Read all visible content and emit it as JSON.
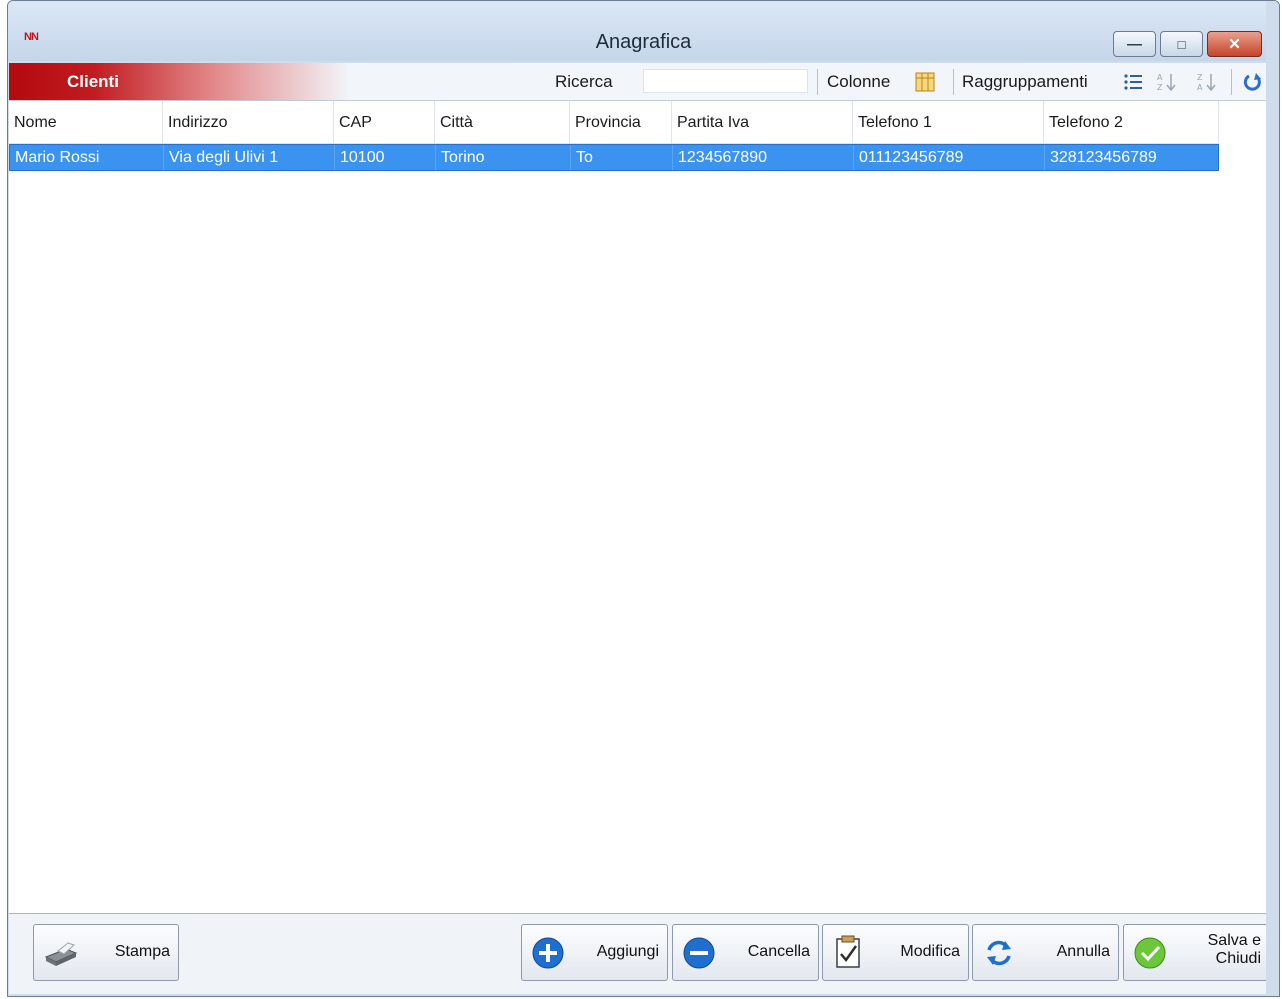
{
  "window": {
    "title": "Anagrafica",
    "app_icon_text": "NN",
    "controls": {
      "minimize": "minimize",
      "maximize": "maximize",
      "close": "close"
    }
  },
  "toolbar": {
    "section_title": "Clienti",
    "search_label": "Ricerca",
    "search_value": "",
    "columns_label": "Colonne",
    "grouping_label": "Raggruppamenti"
  },
  "table": {
    "columns": [
      "Nome",
      "Indirizzo",
      "CAP",
      "Città",
      "Provincia",
      "Partita Iva",
      "Telefono 1",
      "Telefono 2"
    ],
    "rows": [
      [
        "Mario Rossi",
        "Via degli Ulivi 1",
        "10100",
        "Torino",
        "To",
        "1234567890",
        "011123456789",
        "328123456789"
      ]
    ],
    "selected_row": 0,
    "selection_color": "#3b93f0"
  },
  "buttons": {
    "stampa": "Stampa",
    "aggiungi": "Aggiungi",
    "cancella": "Cancella",
    "modifica": "Modifica",
    "annulla": "Annulla",
    "salva_line1": "Salva e",
    "salva_line2": "Chiudi"
  },
  "colors": {
    "accent_red": "#c11c20",
    "close_button": "#c6452c",
    "titlebar": "#c5d6ea"
  }
}
